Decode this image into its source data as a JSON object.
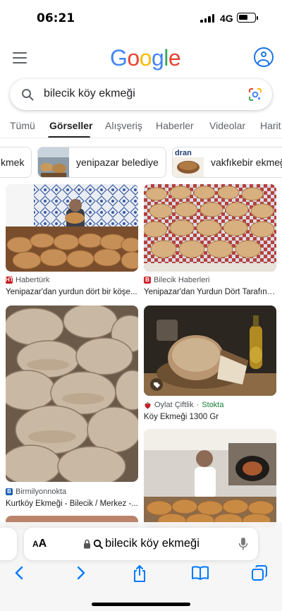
{
  "status": {
    "time": "06:21",
    "network": "4G"
  },
  "google": {
    "logo": [
      "G",
      "o",
      "o",
      "g",
      "l",
      "e"
    ]
  },
  "search": {
    "query": "bilecik köy ekmeği"
  },
  "tabs": [
    "Tümü",
    "Görseller",
    "Alışveriş",
    "Haberler",
    "Videolar",
    "Harit"
  ],
  "active_tab": "Görseller",
  "chips": [
    "kmek",
    "yenipazar belediye",
    "vakfıkebir ekmeği"
  ],
  "chip_thumb_text": "dran",
  "results": [
    {
      "source": "Habertürk",
      "favicon": "HT",
      "title": "Yenipazar'dan yurdun dört bir köşe..."
    },
    {
      "source": "Bilecik Haberleri",
      "favicon": "B",
      "title": "Yenipazar'dan Yurdun Dört Tarafına ..."
    },
    {
      "source": "Birmilyonnokta",
      "favicon": "B",
      "title": "Kurtköy Ekmeği - Bilecik / Merkez -..."
    },
    {
      "source": "Oylat Çiftlik",
      "stock": "Stokta",
      "separator": "·",
      "title": "Köy Ekmeği 1300 Gr"
    }
  ],
  "safari": {
    "text_size_label_small": "A",
    "text_size_label": "A",
    "url": "bilecik köy ekmeği"
  },
  "colors": {
    "google_blue": "#4285f4",
    "google_red": "#ea4335",
    "google_yellow": "#fbbc05",
    "google_green": "#34a853",
    "ios_blue": "#007aff",
    "stock_green": "#188038"
  }
}
